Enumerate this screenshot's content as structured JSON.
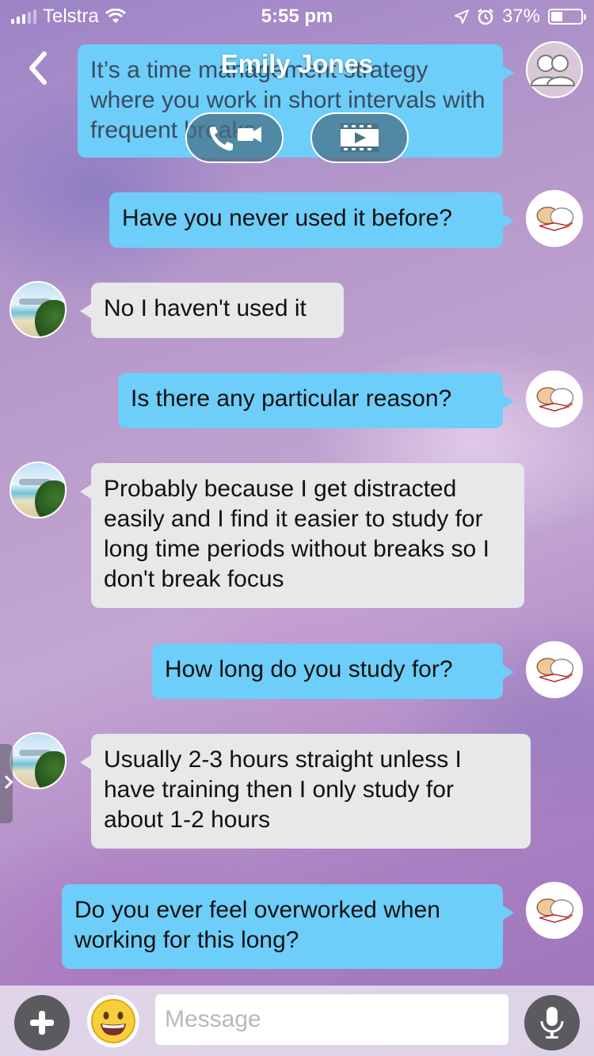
{
  "status_bar": {
    "carrier": "Telstra",
    "time": "5:55 pm",
    "battery_percent": "37%",
    "battery_level": 0.37,
    "icons": [
      "signal-icon",
      "wifi-icon",
      "location-icon",
      "alarm-icon",
      "battery-icon"
    ]
  },
  "header": {
    "title": "Emily Jones",
    "icons": [
      "back-chevron-icon",
      "people-icon",
      "phone-icon",
      "video-camera-icon",
      "screening-room-icon"
    ]
  },
  "messages": [
    {
      "direction": "outgoing",
      "text": "It’s a time management strategy where you work in short intervals with frequent breaks",
      "partially_hidden": true
    },
    {
      "direction": "outgoing",
      "text": "Have you never used it before?"
    },
    {
      "direction": "incoming",
      "text": "No I haven't used it"
    },
    {
      "direction": "outgoing",
      "text": "Is there any particular reason?"
    },
    {
      "direction": "incoming",
      "text": "Probably because I get distracted easily and I find it easier to study for long time periods without breaks so I don't break focus"
    },
    {
      "direction": "outgoing",
      "text": "How long do you study for?"
    },
    {
      "direction": "incoming",
      "text": "Usually 2-3 hours straight unless I have training then I only study for about 1-2 hours"
    },
    {
      "direction": "outgoing",
      "text": "Do you ever feel overworked when working for this long?"
    }
  ],
  "composer": {
    "placeholder": "Message",
    "icons": [
      "plus-icon",
      "emoji-icon",
      "microphone-icon"
    ]
  },
  "colors": {
    "outgoing_bubble": "#6dcef9",
    "incoming_bubble": "#e8e8ea"
  }
}
